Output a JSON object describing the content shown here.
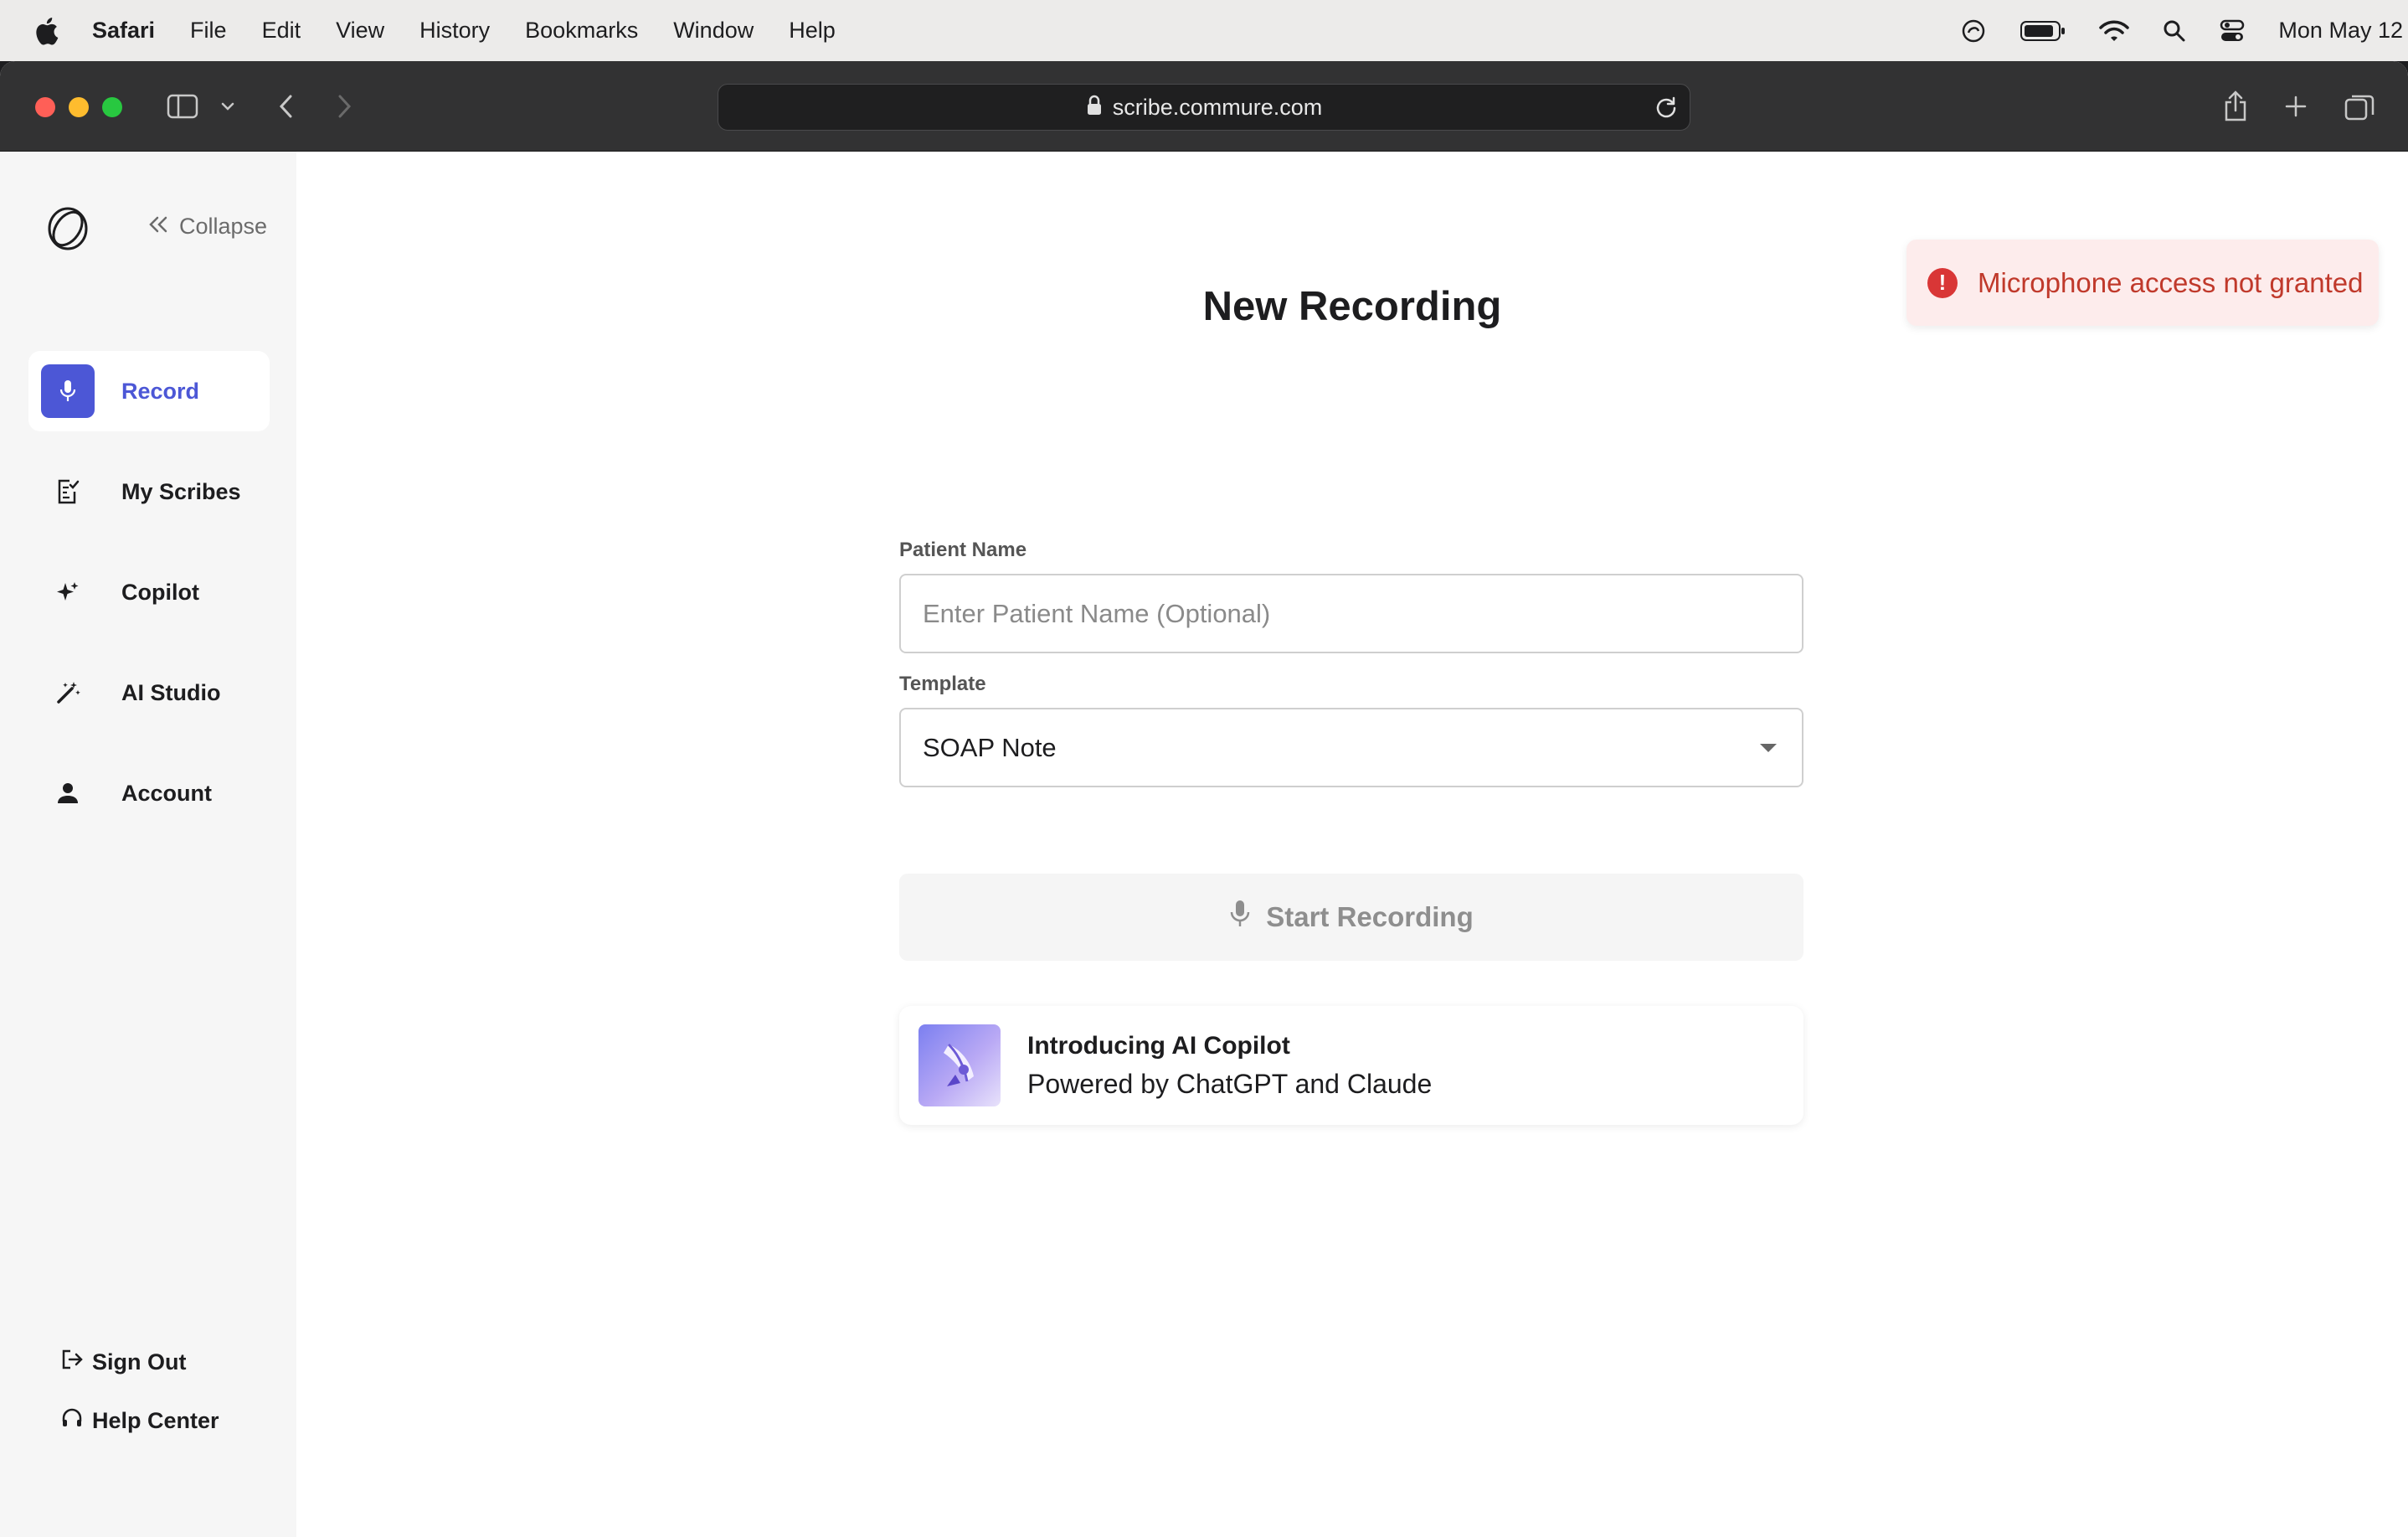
{
  "menubar": {
    "app_name": "Safari",
    "items": [
      "File",
      "Edit",
      "View",
      "History",
      "Bookmarks",
      "Window",
      "Help"
    ],
    "clock": "Mon May 12"
  },
  "browser": {
    "url": "scribe.commure.com"
  },
  "sidebar": {
    "collapse_label": "Collapse",
    "items": [
      {
        "label": "Record",
        "icon": "microphone-icon"
      },
      {
        "label": "My Scribes",
        "icon": "document-check-icon"
      },
      {
        "label": "Copilot",
        "icon": "sparkle-icon"
      },
      {
        "label": "AI Studio",
        "icon": "magic-wand-icon"
      },
      {
        "label": "Account",
        "icon": "person-icon"
      }
    ],
    "sign_out": "Sign Out",
    "help_center": "Help Center"
  },
  "main": {
    "title": "New Recording",
    "patient_label": "Patient Name",
    "patient_placeholder": "Enter Patient Name (Optional)",
    "patient_value": "",
    "template_label": "Template",
    "template_value": "SOAP Note",
    "start_button": "Start Recording",
    "promo_title": "Introducing AI Copilot",
    "promo_subtitle": "Powered by ChatGPT and Claude"
  },
  "toast": {
    "message": "Microphone access not granted"
  },
  "colors": {
    "accent": "#4c57d6",
    "error": "#d93636",
    "error_bg": "#fdecec"
  }
}
